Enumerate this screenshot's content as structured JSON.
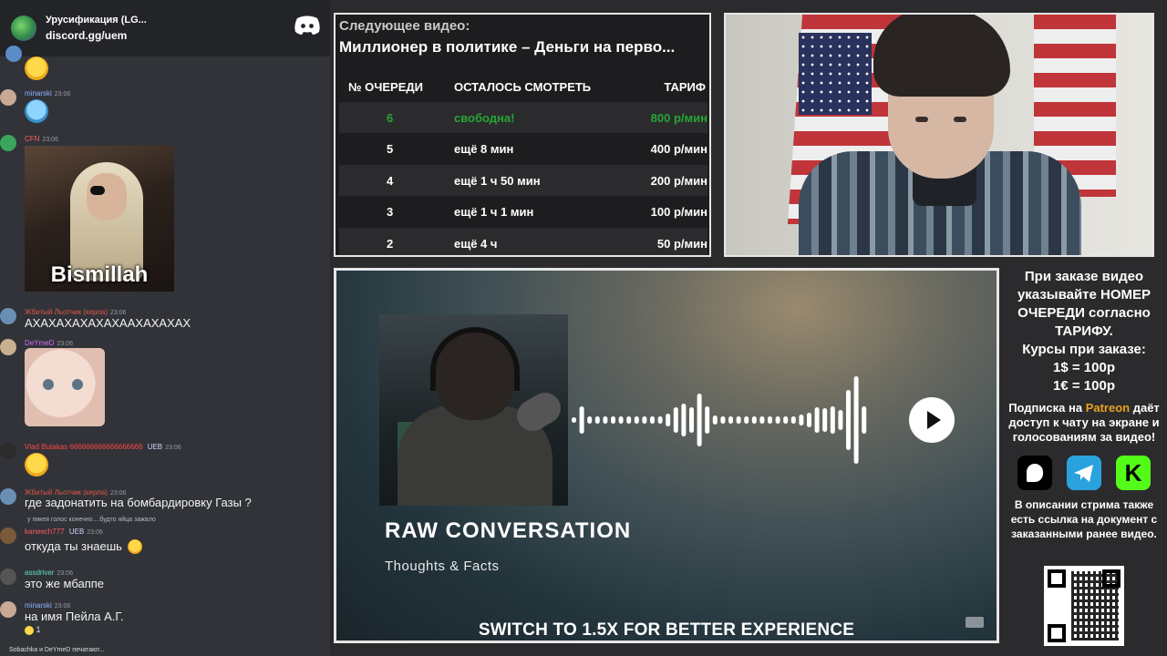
{
  "chat": {
    "server_name": "Урусификация (LG...",
    "server_link": "discord.gg/uem",
    "messages": [
      {
        "user": "minarski",
        "time": "23:06",
        "user_color": "#8fb3ff"
      },
      {
        "user": "CFN",
        "time": "23:06",
        "user_color": "#ff5c5c",
        "image_caption": "Bismillah"
      },
      {
        "user": "Жбитый Льотчик (керла)",
        "time": "23:06",
        "user_color": "#e0554a",
        "text": "АХАХАХАХАХАХААХАХАХАХ"
      },
      {
        "user": "DeYmeD",
        "time": "23:06",
        "user_color": "#d96bff"
      },
      {
        "user": "Vlad Butakas 666666666666666666",
        "time": "23:06",
        "user_color": "#ff4444",
        "badge": "UEB"
      },
      {
        "user": "Жбитый Льотчик (керла)",
        "time": "23:06",
        "user_color": "#e0554a",
        "text": "где задонатить на бомбардировку Газы ?"
      },
      {
        "reply": "у пикея голос конечно....будто яйца зажало",
        "user": "kaneech777",
        "time": "23:06",
        "user_color": "#ff5c5c",
        "badge": "UEB",
        "text": "откуда ты знаешь"
      },
      {
        "user": "assdriver",
        "time": "23:06",
        "user_color": "#5ce0c0",
        "text": "это же мбаппе"
      },
      {
        "user": "minarski",
        "time": "23:06",
        "user_color": "#8fb3ff",
        "text": "на имя Пейла А.Г.",
        "reaction_count": "1"
      }
    ],
    "typing": "Sobachka и DeYmeD печатают..."
  },
  "queue": {
    "label": "Следующее видео:",
    "title": "Миллионер в политике – Деньги на перво...",
    "headers": {
      "num": "№ ОЧЕРЕДИ",
      "left": "ОСТАЛОСЬ СМОТРЕТЬ",
      "rate": "ТАРИФ"
    },
    "rows": [
      {
        "num": "6",
        "left": "свободна!",
        "rate": "800 р/мин"
      },
      {
        "num": "5",
        "left": "ещё 8 мин",
        "rate": "400 р/мин"
      },
      {
        "num": "4",
        "left": "ещё 1 ч 50 мин",
        "rate": "200 р/мин"
      },
      {
        "num": "3",
        "left": "ещё 1 ч 1 мин",
        "rate": "100 р/мин"
      },
      {
        "num": "2",
        "left": "ещё 4 ч",
        "rate": "50 р/мин"
      }
    ],
    "free_color": "#27a635"
  },
  "video": {
    "title": "RAW CONVERSATION",
    "subtitle": "Thoughts & Facts",
    "banner": "SWITCH TO 1.5X FOR BETTER EXPERIENCE"
  },
  "info": {
    "order_text": "При заказе видео указывайте НОМЕР ОЧЕРЕДИ согласно ТАРИФУ.",
    "rates_title": "Курсы при заказе:",
    "rate_usd": "1$ = 100р",
    "rate_eur": "1€ = 100р",
    "sub_before": "Подписка на",
    "sub_patreon": "Patreon",
    "sub_after": "даёт доступ к чату на экране и голосованиям за видео!",
    "doc_text": "В описании стрима также есть ссылка на документ с заказанными ранее видео.",
    "kick_letter": "K"
  },
  "colors": {
    "discord_blurple": "#5865f2",
    "patreon": "#e8a020",
    "kick": "#53fc18",
    "telegram": "#2aa2dd"
  }
}
